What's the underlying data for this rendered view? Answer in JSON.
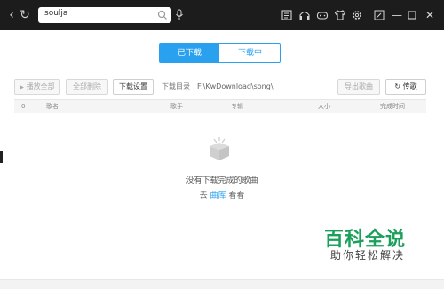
{
  "topbar": {
    "search_value": "soulja",
    "icons": [
      "back-icon",
      "refresh-icon",
      "search-icon",
      "mic-icon",
      "music-library-icon",
      "headphones-icon",
      "gamepad-icon",
      "tshirt-icon",
      "settings-icon",
      "minimize-to-mini-icon",
      "minimize-icon",
      "maximize-icon",
      "close-icon"
    ]
  },
  "tabs": {
    "downloaded": "已下载",
    "downloading": "下载中"
  },
  "toolbar": {
    "play_all": "播放全部",
    "delete_all": "全部删除",
    "download_settings": "下载设置",
    "download_dir_label": "下载目录",
    "download_dir_path": "F:\\KwDownload\\song\\",
    "export_songs": "导出歌曲",
    "upload": "传歌"
  },
  "table": {
    "headers": [
      "0",
      "歌名",
      "歌手",
      "专辑",
      "大小",
      "完成时间"
    ]
  },
  "empty_state": {
    "message": "没有下载完成的歌曲",
    "goto_prefix": "去",
    "goto_link": "曲库",
    "goto_suffix": "看看"
  },
  "watermark": {
    "title": "百科全说",
    "subtitle": "助你轻松解决"
  },
  "colors": {
    "accent": "#2aa1ee",
    "topbar": "#1c1c1c",
    "watermark_green": "#1aa05a"
  }
}
